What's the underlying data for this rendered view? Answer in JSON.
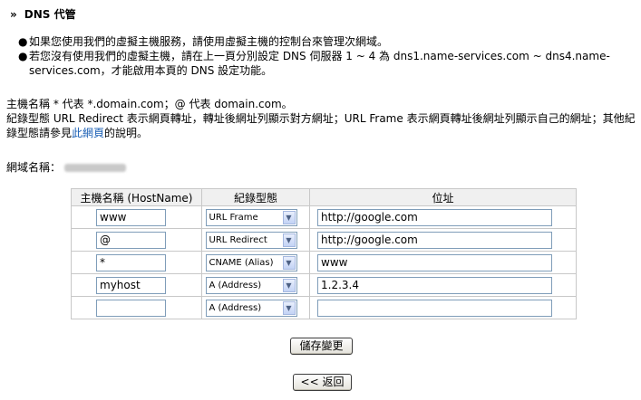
{
  "page": {
    "arrow": "»",
    "title": "DNS 代管"
  },
  "notes": [
    "如果您使用我們的虛擬主機服務，請使用虛擬主機的控制台來管理次網域。",
    "若您沒有使用我們的虛擬主機，請在上一頁分別設定 DNS 伺服器 1 ~ 4 為 dns1.name-services.com ~ dns4.name-services.com，才能啟用本頁的 DNS 設定功能。"
  ],
  "desc": {
    "line1": "主機名稱 * 代表 *.domain.com；@ 代表 domain.com。",
    "line2_pre": "紀錄型態 URL Redirect 表示網頁轉址，轉址後網址列顯示對方網址；URL Frame 表示網頁轉址後網址列顯示自己的網址；其他紀錄型態請參見",
    "link": "此網頁",
    "line2_post": "的說明。"
  },
  "domain": {
    "label": "網域名稱："
  },
  "table": {
    "headers": [
      "主機名稱 (HostName)",
      "紀錄型態",
      "位址"
    ],
    "rows": [
      {
        "host": "www",
        "type": "URL Frame",
        "value": "http://google.com"
      },
      {
        "host": "@",
        "type": "URL Redirect",
        "value": "http://google.com"
      },
      {
        "host": "*",
        "type": "CNAME (Alias)",
        "value": "www"
      },
      {
        "host": "myhost",
        "type": "A (Address)",
        "value": "1.2.3.4"
      },
      {
        "host": "",
        "type": "A (Address)",
        "value": ""
      }
    ]
  },
  "buttons": {
    "save": "儲存變更",
    "back": "<< 返回"
  },
  "icons": {
    "dropdown": "chevron-down-icon"
  }
}
